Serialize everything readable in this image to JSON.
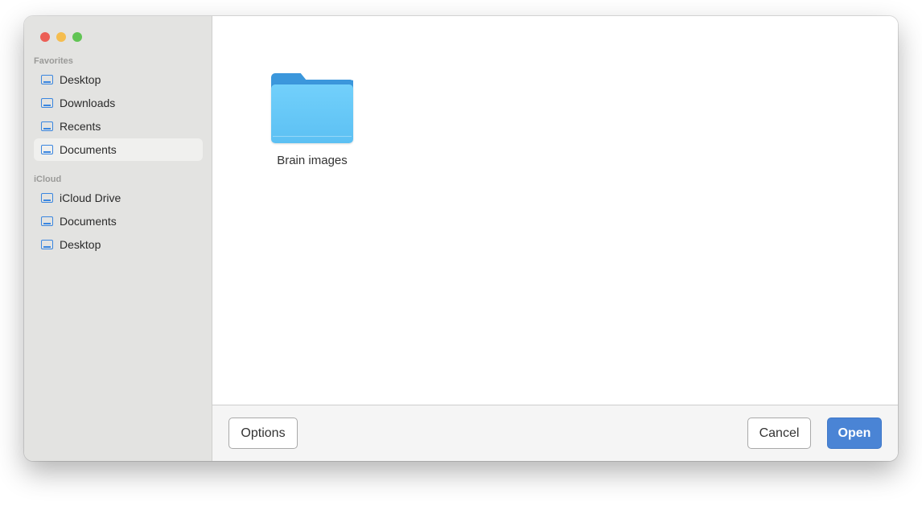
{
  "window": {
    "traffic_lights": {
      "close_color": "#ec5f56",
      "minimize_color": "#f5bd4f",
      "zoom_color": "#61c454"
    }
  },
  "sidebar": {
    "favorites_title": "Favorites",
    "favorites": [
      {
        "label": "Desktop",
        "icon": "drive-icon",
        "selected": false
      },
      {
        "label": "Downloads",
        "icon": "drive-icon",
        "selected": false
      },
      {
        "label": "Recents",
        "icon": "drive-icon",
        "selected": false
      },
      {
        "label": "Documents",
        "icon": "drive-icon",
        "selected": true
      }
    ],
    "icloud_title": "iCloud",
    "icloud": [
      {
        "label": "iCloud Drive",
        "icon": "drive-icon",
        "selected": false
      },
      {
        "label": "Documents",
        "icon": "drive-icon",
        "selected": false
      },
      {
        "label": "Desktop",
        "icon": "drive-icon",
        "selected": false
      }
    ]
  },
  "content": {
    "items": [
      {
        "label": "Brain images",
        "icon": "folder-icon"
      }
    ]
  },
  "footer": {
    "options_label": "Options",
    "cancel_label": "Cancel",
    "open_label": "Open"
  },
  "colors": {
    "accent": "#4a84d5",
    "sidebar_icon": "#3a86e0",
    "folder": "#62c4f6"
  }
}
